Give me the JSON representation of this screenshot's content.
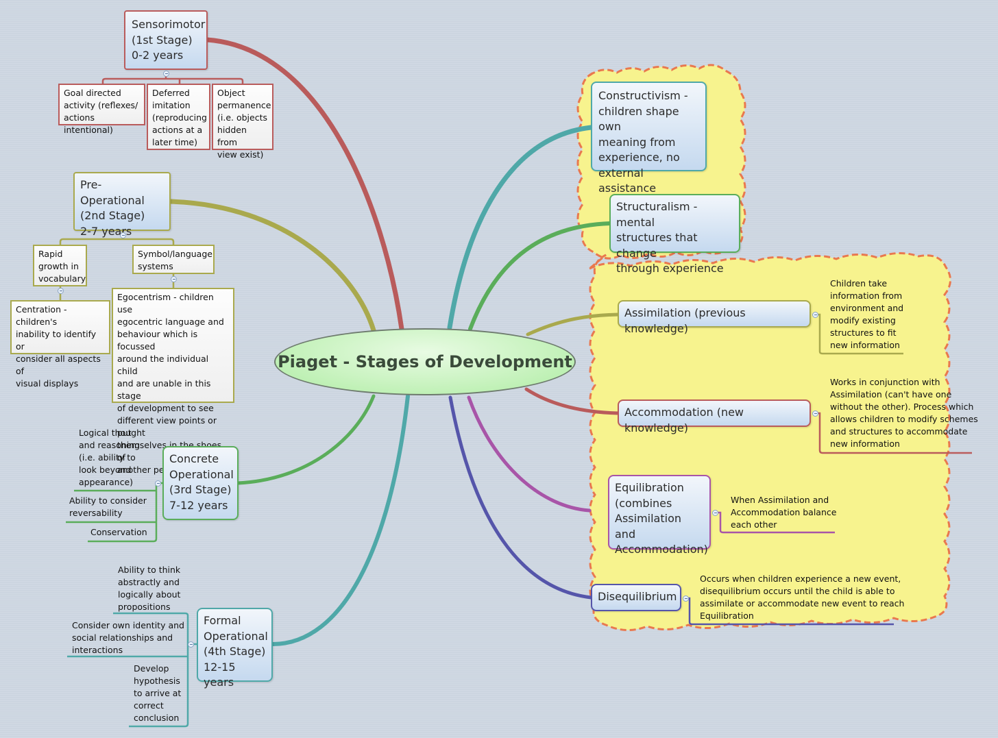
{
  "central_topic": "Piaget - Stages of Development",
  "colors": {
    "sensorimotor": "#b95b5b",
    "pre_operational": "#a9a94d",
    "concrete": "#5aad5a",
    "formal": "#4fa8a8",
    "constructivism": "#4fa8a8",
    "structuralism": "#5aad5a",
    "assimilation": "#a9a94d",
    "accommodation": "#b95b5b",
    "equilibration": "#a855a8",
    "disequilibrium": "#5555aa",
    "cloud_fill": "#f7f38e",
    "cloud_border": "#e9784e",
    "central_fill": "#c9f3c0"
  },
  "stages": {
    "sensorimotor": {
      "title": "Sensorimotor\n(1st Stage)\n0-2 years",
      "children": [
        "Goal directed\nactivity (reflexes/\nactions intentional)",
        "Deferred\nimitation\n(reproducing\nactions at a\nlater time)",
        "Object\npermanence\n(i.e. objects\nhidden from\nview exist)"
      ]
    },
    "pre_operational": {
      "title": "Pre-Operational\n (2nd Stage)\n2-7 years",
      "children": [
        "Rapid\ngrowth in\nvocabulary",
        "Symbol/language\nsystems"
      ],
      "grandchildren": {
        "rapid_growth": "Centration - children's\ninability to identify or\nconsider all aspects of\nvisual displays",
        "symbol_language": "Egocentrism - children use\negocentric  language and\nbehaviour which is focussed\naround the individual child\nand are unable in this stage\nof development to see\ndifferent view points or put\nthemselves in the shoes of\nanother person."
      }
    },
    "concrete": {
      "title": "Concrete\nOperational\n(3rd Stage)\n7-12 years",
      "children": [
        "Logical thought\nand reasoning\n(i.e. ability to\nlook beyond\nappearance)",
        "Ability to consider\nreversability",
        "Conservation"
      ]
    },
    "formal": {
      "title": "Formal\nOperational\n(4th Stage)\n12-15 years",
      "children": [
        "Ability to think\nabstractly and\nlogically about\npropositions",
        "Consider own identity and\nsocial relationships and\ninteractions",
        "Develop\nhypothesis\nto arrive at\ncorrect\nconclusion"
      ]
    }
  },
  "theories": {
    "constructivism": "Constructivism -\nchildren shape own\nmeaning from\nexperience, no\nexternal assistance",
    "structuralism": "Structuralism - mental\nstructures that change\nthrough experience"
  },
  "processes": {
    "assimilation": {
      "title": "Assimilation (previous knowledge)",
      "note": "Children take\ninformation from\nenvironment and\nmodify existing\nstructures to fit\nnew information"
    },
    "accommodation": {
      "title": "Accommodation (new knowledge)",
      "note": "Works in conjunction with\nAssimilation (can't have one\nwithout the other). Process which\nallows children to modify schemes\nand structures to accommodate\nnew information"
    },
    "equilibration": {
      "title": "Equilibration\n(combines\nAssimilation and\nAccommodation)",
      "note": "When Assimilation and\nAccommodation balance\neach other"
    },
    "disequilibrium": {
      "title": "Disequilibrium",
      "note": "Occurs when children experience a new event,\ndisequilibrium occurs until the child is able to\nassimilate or accommodate new event to reach\nEquilibration"
    }
  }
}
